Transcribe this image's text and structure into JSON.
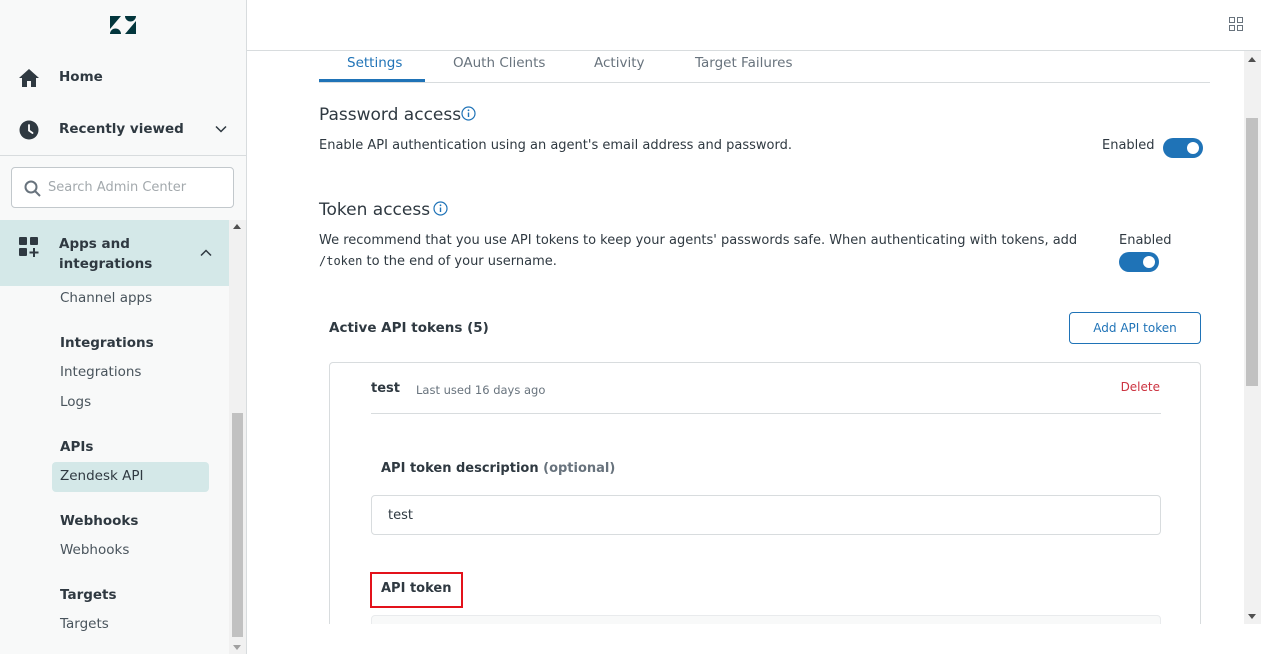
{
  "sidebar": {
    "logo": "zendesk-logo",
    "home_label": "Home",
    "recent_label": "Recently viewed",
    "search_placeholder": "Search Admin Center",
    "section": {
      "label": "Apps and integrations",
      "icon": "apps-icon"
    },
    "items": {
      "channel_apps": "Channel apps",
      "integrations_head": "Integrations",
      "integrations": "Integrations",
      "logs": "Logs",
      "apis_head": "APIs",
      "zendesk_api": "Zendesk API",
      "webhooks_head": "Webhooks",
      "webhooks": "Webhooks",
      "targets_head": "Targets",
      "targets": "Targets"
    }
  },
  "tabs": [
    {
      "label": "Settings",
      "active": true
    },
    {
      "label": "OAuth Clients",
      "active": false
    },
    {
      "label": "Activity",
      "active": false
    },
    {
      "label": "Target Failures",
      "active": false
    }
  ],
  "password_access": {
    "title": "Password access",
    "description": "Enable API authentication using an agent's email address and password.",
    "status": "Enabled"
  },
  "token_access": {
    "title": "Token access",
    "description_pre": "We recommend that you use API tokens to keep your agents' passwords safe. When authenticating with tokens, add ",
    "description_code": "/token",
    "description_post": " to the end of your username.",
    "status": "Enabled"
  },
  "active_tokens": {
    "title": "Active API tokens (5)",
    "add_button": "Add API token",
    "token": {
      "name": "test",
      "last_used": "Last used 16 days ago",
      "delete_label": "Delete",
      "description_label": "API token description",
      "optional_label": "(optional)",
      "description_value": "test",
      "token_label": "API token"
    }
  },
  "colors": {
    "accent": "#1f73b7",
    "sidebar_active": "#d4e8e8",
    "delete": "#cc3340",
    "highlight": "#e3121b"
  }
}
